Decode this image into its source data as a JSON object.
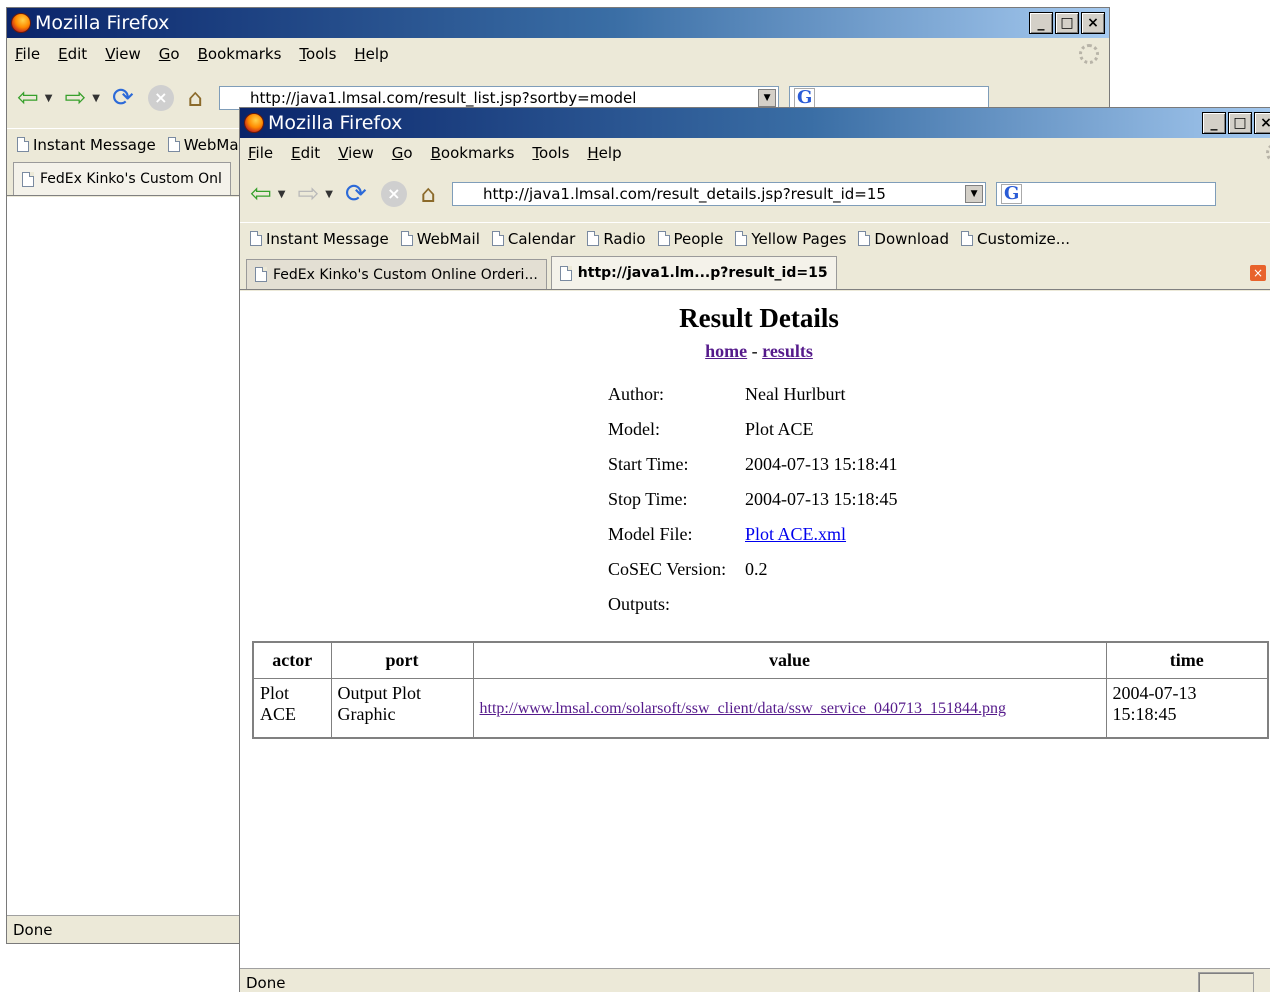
{
  "back_window": {
    "title": "Mozilla Firefox",
    "window_buttons": [
      "_",
      "□",
      "×"
    ],
    "menu": [
      "File",
      "Edit",
      "View",
      "Go",
      "Bookmarks",
      "Tools",
      "Help"
    ],
    "url": "http://java1.lmsal.com/result_list.jsp?sortby=model",
    "bookmarks": [
      "Instant Message",
      "WebMail"
    ],
    "tab_label": "FedEx Kinko's Custom Onl",
    "status": "Done"
  },
  "front_window": {
    "title": "Mozilla Firefox",
    "window_buttons": [
      "_",
      "□",
      "×"
    ],
    "menu": [
      "File",
      "Edit",
      "View",
      "Go",
      "Bookmarks",
      "Tools",
      "Help"
    ],
    "url": "http://java1.lmsal.com/result_details.jsp?result_id=15",
    "bookmarks": [
      "Instant Message",
      "WebMail",
      "Calendar",
      "Radio",
      "People",
      "Yellow Pages",
      "Download",
      "Customize..."
    ],
    "tabs": [
      "FedEx Kinko's Custom Online Orderi...",
      "http://java1.lm...p?result_id=15"
    ],
    "status": "Done"
  },
  "page": {
    "title": "Result Details",
    "nav_home": "home",
    "nav_separator": " - ",
    "nav_results": "results",
    "details": [
      {
        "label": "Author:",
        "value": "Neal Hurlburt"
      },
      {
        "label": "Model:",
        "value": "Plot ACE"
      },
      {
        "label": "Start Time:",
        "value": "2004-07-13 15:18:41"
      },
      {
        "label": "Stop Time:",
        "value": "2004-07-13 15:18:45"
      },
      {
        "label": "Model File:",
        "value": "Plot ACE.xml"
      },
      {
        "label": "CoSEC Version:",
        "value": "0.2"
      },
      {
        "label": "Outputs:",
        "value": ""
      }
    ],
    "table": {
      "headers": [
        "actor",
        "port",
        "value",
        "time"
      ],
      "rows": [
        {
          "actor": [
            "Plot",
            "ACE"
          ],
          "port": [
            "Output Plot",
            "Graphic"
          ],
          "value": "http://www.lmsal.com/solarsoft/ssw_client/data/ssw_service_040713_151844.png",
          "time": [
            "2004-07-13",
            "15:18:45"
          ]
        }
      ]
    }
  },
  "colors": {
    "titlebar_start": "#0a246a",
    "chrome_bg": "#ece9d8",
    "visited_link": "#551a8b",
    "link": "#0000ee"
  }
}
